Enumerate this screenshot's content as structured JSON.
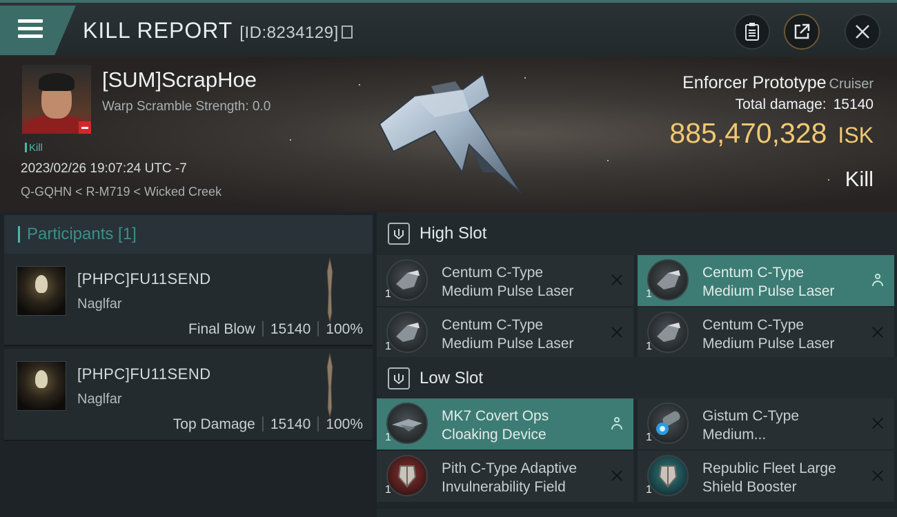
{
  "header": {
    "title": "KILL REPORT",
    "report_id": "[ID:8234129]"
  },
  "victim": {
    "name": "[SUM]ScrapHoe",
    "warp_scramble": "Warp Scramble Strength: 0.0",
    "kill_tag": "Kill",
    "timestamp": "2023/02/26 19:07:24 UTC -7",
    "location": "Q-GQHN < R-M719 < Wicked Creek"
  },
  "ship": {
    "name": "Enforcer Prototype",
    "class": "Cruiser",
    "total_damage_label": "Total damage:",
    "total_damage": "15140",
    "isk_value": "885,470,328",
    "isk_unit": "ISK",
    "result": "Kill"
  },
  "participants": {
    "header": "Participants [1]",
    "rows": [
      {
        "name": "[PHPC]FU11SEND",
        "ship": "Naglfar",
        "role": "Final Blow",
        "damage": "15140",
        "percent": "100%"
      },
      {
        "name": "[PHPC]FU11SEND",
        "ship": "Naglfar",
        "role": "Top Damage",
        "damage": "15140",
        "percent": "100%"
      }
    ]
  },
  "slots": {
    "high": {
      "label": "High Slot",
      "items": [
        {
          "qty": "1",
          "line1": "Centum C-Type",
          "line2": "Medium Pulse Laser",
          "highlighted": false
        },
        {
          "qty": "1",
          "line1": "Centum C-Type",
          "line2": "Medium Pulse Laser",
          "highlighted": true
        },
        {
          "qty": "1",
          "line1": "Centum C-Type",
          "line2": "Medium Pulse Laser",
          "highlighted": false
        },
        {
          "qty": "1",
          "line1": "Centum C-Type",
          "line2": "Medium Pulse Laser",
          "highlighted": false
        }
      ]
    },
    "low": {
      "label": "Low Slot",
      "items": [
        {
          "qty": "1",
          "line1": "MK7 Covert Ops",
          "line2": "Cloaking Device",
          "highlighted": true
        },
        {
          "qty": "1",
          "line1": "Gistum C-Type",
          "line2": "Medium...",
          "highlighted": false
        },
        {
          "qty": "1",
          "line1": "Pith C-Type Adaptive",
          "line2": "Invulnerability Field",
          "highlighted": false
        },
        {
          "qty": "1",
          "line1": "Republic Fleet Large",
          "line2": "Shield Booster",
          "highlighted": false
        }
      ]
    }
  },
  "colors": {
    "accent_teal": "#3c7c74",
    "isk_gold": "#f0c874",
    "badge_red": "#d3282a"
  },
  "icons": [
    "menu-icon",
    "copy-icon",
    "clipboard-icon",
    "share-icon",
    "close-icon",
    "slot-shield-icon",
    "remove-icon",
    "pilot-icon"
  ]
}
